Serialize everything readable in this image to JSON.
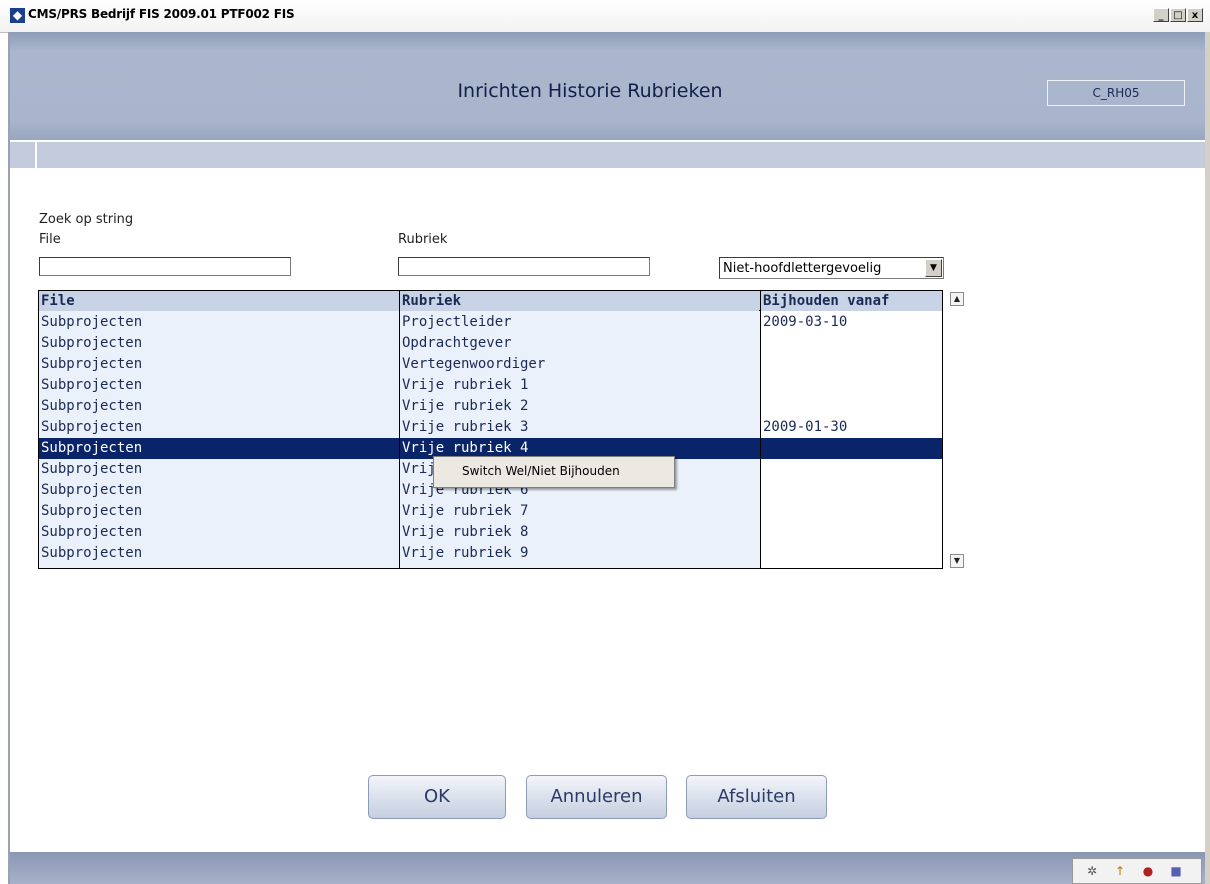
{
  "window": {
    "title": "CMS/PRS  Bedrijf FIS 2009.01  PTF002 FIS",
    "minimize": "_",
    "maximize": "□",
    "close": "x"
  },
  "header": {
    "title": "Inrichten Historie Rubrieken",
    "screen_code": "C_RH05"
  },
  "search": {
    "heading": "Zoek op string",
    "file_label": "File",
    "file_value": "",
    "rubriek_label": "Rubriek",
    "rubriek_value": "",
    "case_option": "Niet-hoofdlettergevoelig"
  },
  "table": {
    "columns": [
      "File",
      "Rubriek",
      "Bijhouden vanaf"
    ],
    "rows": [
      {
        "file": "Subprojecten",
        "rubriek": "Projectleider",
        "vanaf": "2009-03-10"
      },
      {
        "file": "Subprojecten",
        "rubriek": "Opdrachtgever",
        "vanaf": ""
      },
      {
        "file": "Subprojecten",
        "rubriek": "Vertegenwoordiger",
        "vanaf": ""
      },
      {
        "file": "Subprojecten",
        "rubriek": "Vrije rubriek 1",
        "vanaf": ""
      },
      {
        "file": "Subprojecten",
        "rubriek": "Vrije rubriek 2",
        "vanaf": ""
      },
      {
        "file": "Subprojecten",
        "rubriek": "Vrije rubriek 3",
        "vanaf": "2009-01-30"
      },
      {
        "file": "Subprojecten",
        "rubriek": "Vrije rubriek 4",
        "vanaf": ""
      },
      {
        "file": "Subprojecten",
        "rubriek": "Vrije rubriek 5",
        "vanaf": ""
      },
      {
        "file": "Subprojecten",
        "rubriek": "Vrije rubriek 6",
        "vanaf": ""
      },
      {
        "file": "Subprojecten",
        "rubriek": "Vrije rubriek 7",
        "vanaf": ""
      },
      {
        "file": "Subprojecten",
        "rubriek": "Vrije rubriek 8",
        "vanaf": ""
      },
      {
        "file": "Subprojecten",
        "rubriek": "Vrije rubriek 9",
        "vanaf": ""
      }
    ],
    "selected_row": 6,
    "scroll_up": "▲",
    "scroll_down": "▼"
  },
  "context_menu": {
    "item": "Switch Wel/Niet Bijhouden"
  },
  "buttons": {
    "ok": "OK",
    "cancel": "Annuleren",
    "close": "Afsluiten"
  },
  "tray_icons": [
    "tools-icon",
    "pin-icon",
    "user-icon",
    "cube-icon"
  ],
  "colors": {
    "header": "#aab6cd",
    "selection": "#0a246a",
    "text": "#1b2a55"
  }
}
